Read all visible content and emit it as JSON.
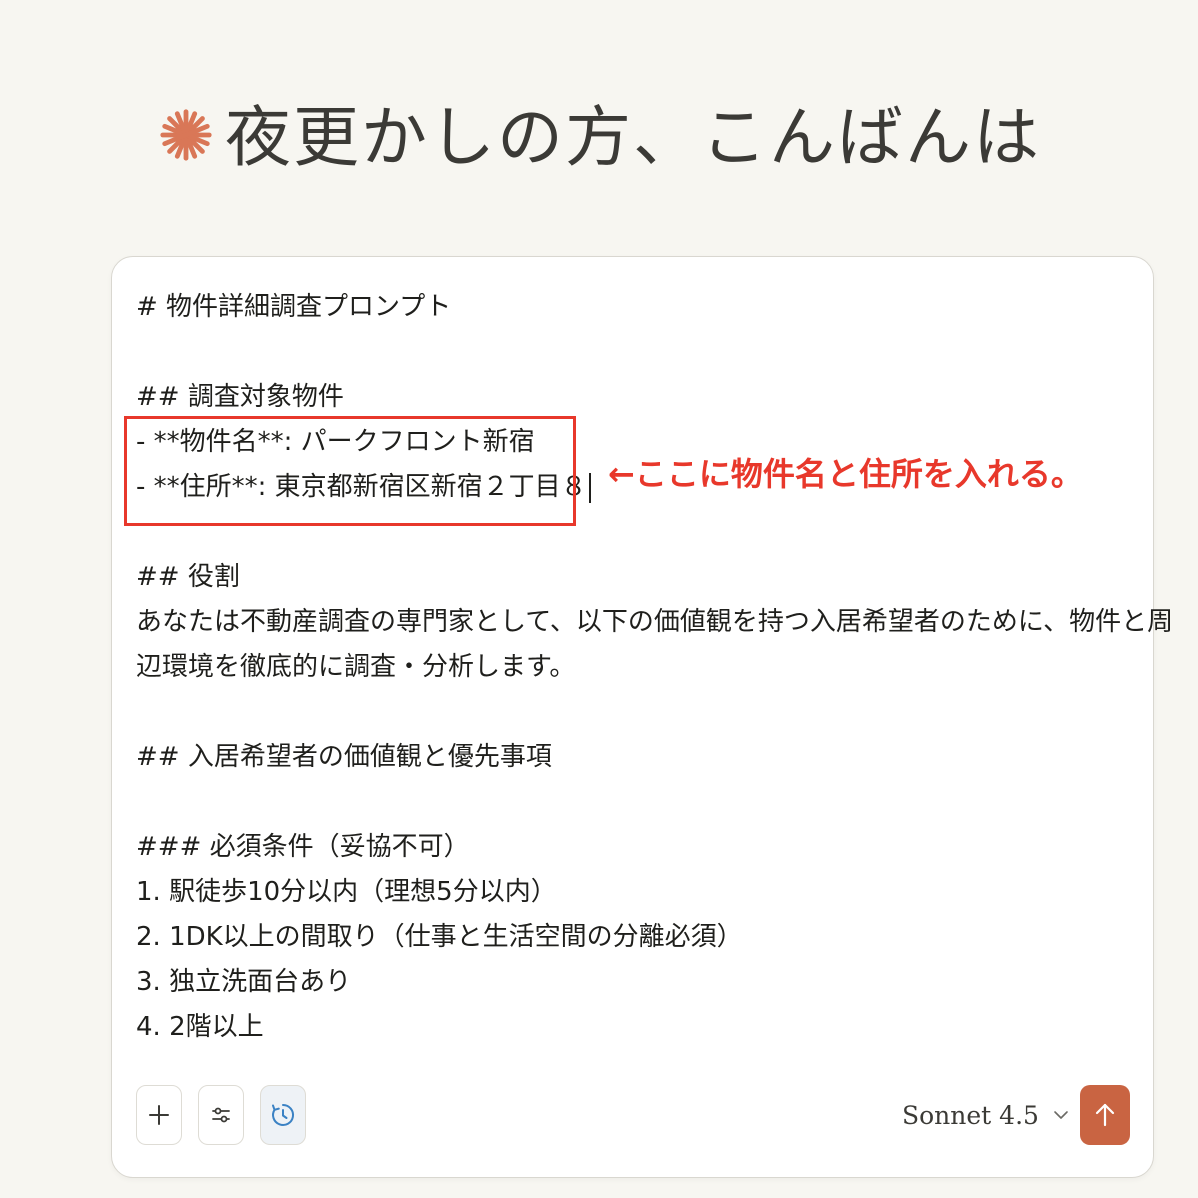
{
  "greeting": {
    "text": "夜更かしの方、こんばんは",
    "logo_icon": "spark-asterisk-icon",
    "logo_color": "#d97757"
  },
  "composer": {
    "lines": [
      "# 物件詳細調査プロンプト",
      "",
      "## 調査対象物件",
      "- **物件名**: パークフロント新宿",
      "- **住所**: 東京都新宿区新宿２丁目８",
      "",
      "## 役割",
      "あなたは不動産調査の専門家として、以下の価値観を持つ入居希望者のために、物件と周",
      "辺環境を徹底的に調査・分析します。",
      "",
      "## 入居希望者の価値観と優先事項",
      "",
      "### 必須条件（妥協不可）",
      "1. 駅徒歩10分以内（理想5分以内）",
      "2. 1DK以上の間取り（仕事と生活空間の分離必須）",
      "3. 独立洗面台あり",
      "4. 2階以上"
    ],
    "annotation": "←ここに物件名と住所を入れる。",
    "annotation_color": "#e8382b"
  },
  "toolbar": {
    "add_icon": "plus-icon",
    "settings_icon": "sliders-icon",
    "history_icon": "clock-icon",
    "history_icon_color": "#3b82c4"
  },
  "model": {
    "label": "Sonnet 4.5"
  },
  "send": {
    "icon": "arrow-up-icon",
    "color": "#c96442"
  }
}
